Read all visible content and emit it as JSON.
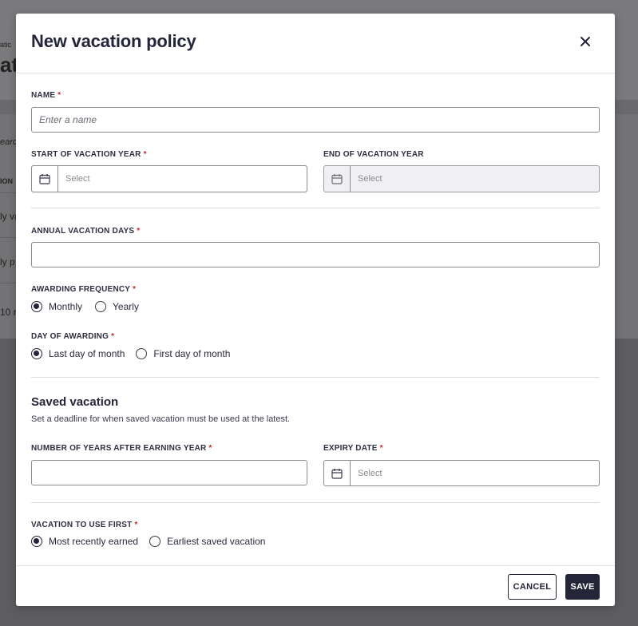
{
  "background": {
    "fragments": [
      "atic",
      "ati",
      "earc",
      "ION",
      "ly va",
      "ly p",
      "10 r"
    ]
  },
  "modal": {
    "title": "New vacation policy",
    "name": {
      "label": "NAME",
      "placeholder": "Enter a name",
      "value": ""
    },
    "start_year": {
      "label": "START OF VACATION YEAR",
      "placeholder": "Select"
    },
    "end_year": {
      "label": "END OF VACATION YEAR",
      "placeholder": "Select"
    },
    "annual_days": {
      "label": "ANNUAL VACATION DAYS",
      "value": ""
    },
    "awarding_frequency": {
      "label": "AWARDING FREQUENCY",
      "options": [
        "Monthly",
        "Yearly"
      ],
      "selected": "Monthly"
    },
    "day_of_awarding": {
      "label": "DAY OF AWARDING",
      "options": [
        "Last day of month",
        "First day of month"
      ],
      "selected": "Last day of month"
    },
    "saved_vacation": {
      "title": "Saved vacation",
      "description": "Set a deadline for when saved vacation must be used at the latest."
    },
    "years_after": {
      "label": "NUMBER OF YEARS AFTER EARNING YEAR",
      "value": ""
    },
    "expiry_date": {
      "label": "EXPIRY DATE",
      "placeholder": "Select"
    },
    "use_first": {
      "label": "VACATION TO USE FIRST",
      "options": [
        "Most recently earned",
        "Earliest saved vacation"
      ],
      "selected": "Most recently earned"
    },
    "required_marker": "*",
    "buttons": {
      "cancel": "CANCEL",
      "save": "SAVE"
    }
  },
  "colors": {
    "accent": "#25253a",
    "required": "#c62828",
    "overlay": "#6f6f72"
  },
  "icons": {
    "close": "close-icon",
    "calendar": "calendar-icon"
  }
}
